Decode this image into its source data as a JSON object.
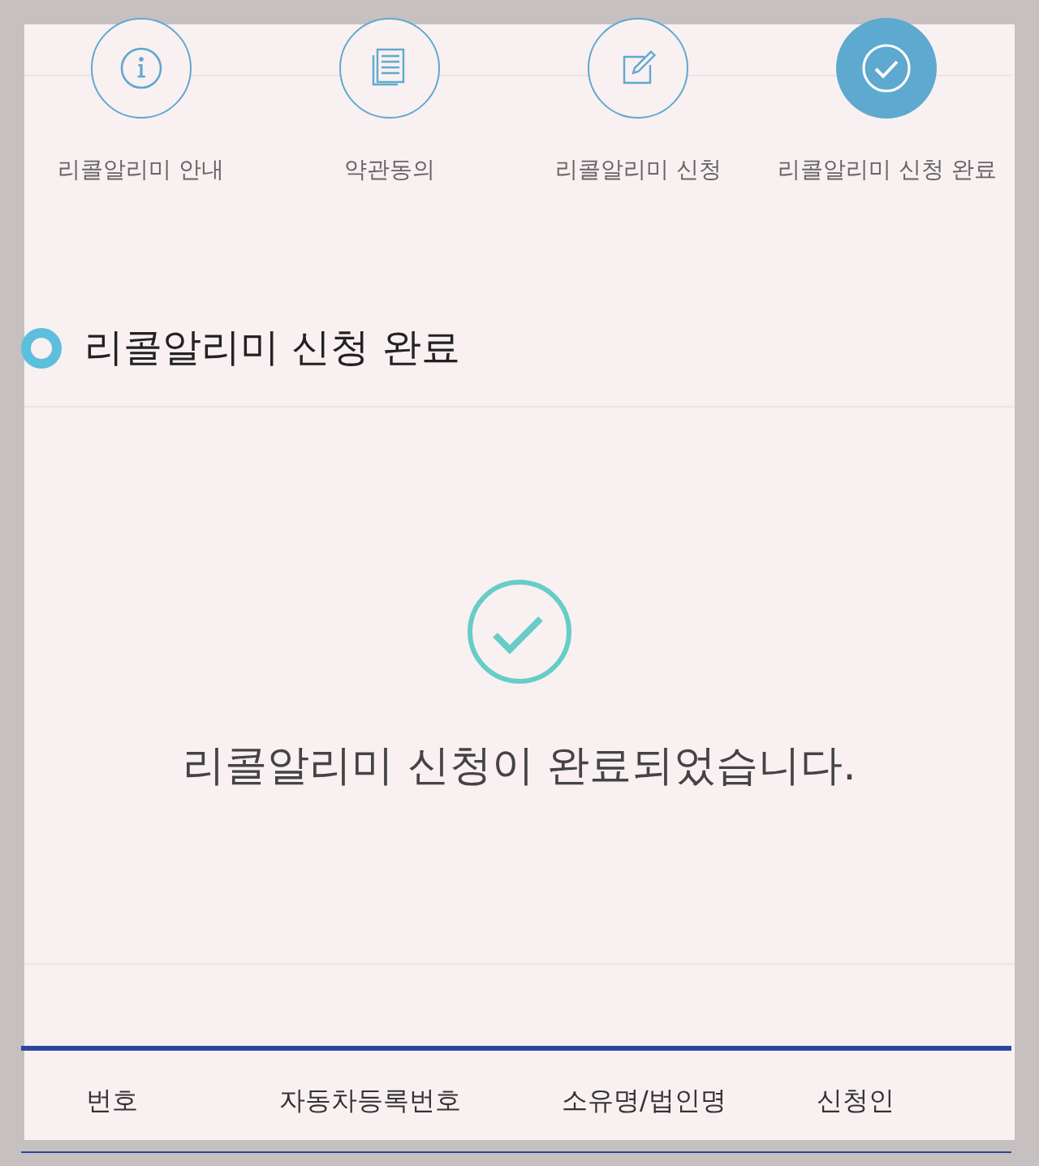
{
  "steps": [
    {
      "kind": "info",
      "label": "리콜알리미 안내",
      "selected": false
    },
    {
      "kind": "document",
      "label": "약관동의",
      "selected": false
    },
    {
      "kind": "edit",
      "label": "리콜알리미 신청",
      "selected": false
    },
    {
      "kind": "check",
      "label": "리콜알리미 신청 완료",
      "selected": true
    }
  ],
  "section": {
    "title": "리콜알리미 신청 완료"
  },
  "result": {
    "message": "리콜알리미 신청이 완료되었습니다."
  },
  "table": {
    "columns": [
      "번호",
      "자동차등록번호",
      "소유명/법인명",
      "신청인"
    ]
  }
}
